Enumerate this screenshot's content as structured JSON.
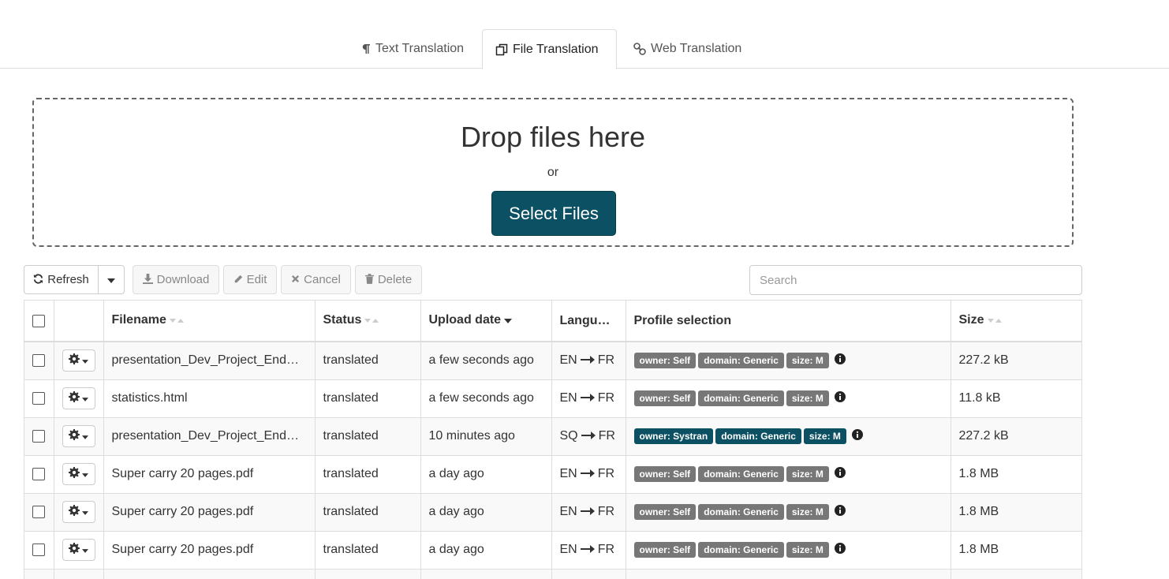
{
  "tabs": [
    {
      "label": "Text Translation",
      "icon": "pilcrow-icon",
      "active": false
    },
    {
      "label": "File Translation",
      "icon": "copy-icon",
      "active": true
    },
    {
      "label": "Web Translation",
      "icon": "link-icon",
      "active": false
    }
  ],
  "dropzone": {
    "title": "Drop files here",
    "or": "or",
    "button": "Select Files"
  },
  "toolbar": {
    "refresh": "Refresh",
    "download": "Download",
    "edit": "Edit",
    "cancel": "Cancel",
    "delete": "Delete",
    "search_placeholder": "Search"
  },
  "table": {
    "columns": {
      "filename": "Filename",
      "status": "Status",
      "upload_date": "Upload date",
      "language": "Langu…",
      "profile": "Profile selection",
      "size": "Size"
    },
    "rows": [
      {
        "filename": "presentation_Dev_Project_End…",
        "status": "translated",
        "date": "a few seconds ago",
        "src": "EN",
        "tgt": "FR",
        "owner": "owner: Self",
        "domain": "domain: Generic",
        "size_badge": "size: M",
        "size": "227.2 kB",
        "badge_color": "#777777"
      },
      {
        "filename": "statistics.html",
        "status": "translated",
        "date": "a few seconds ago",
        "src": "EN",
        "tgt": "FR",
        "owner": "owner: Self",
        "domain": "domain: Generic",
        "size_badge": "size: M",
        "size": "11.8 kB",
        "badge_color": "#777777"
      },
      {
        "filename": "presentation_Dev_Project_End…",
        "status": "translated",
        "date": "10 minutes ago",
        "src": "SQ",
        "tgt": "FR",
        "owner": "owner: Systran",
        "domain": "domain: Generic",
        "size_badge": "size: M",
        "size": "227.2 kB",
        "badge_color": "#0b5063"
      },
      {
        "filename": "Super carry 20 pages.pdf",
        "status": "translated",
        "date": "a day ago",
        "src": "EN",
        "tgt": "FR",
        "owner": "owner: Self",
        "domain": "domain: Generic",
        "size_badge": "size: M",
        "size": "1.8 MB",
        "badge_color": "#777777"
      },
      {
        "filename": "Super carry 20 pages.pdf",
        "status": "translated",
        "date": "a day ago",
        "src": "EN",
        "tgt": "FR",
        "owner": "owner: Self",
        "domain": "domain: Generic",
        "size_badge": "size: M",
        "size": "1.8 MB",
        "badge_color": "#777777"
      },
      {
        "filename": "Super carry 20 pages.pdf",
        "status": "translated",
        "date": "a day ago",
        "src": "EN",
        "tgt": "FR",
        "owner": "owner: Self",
        "domain": "domain: Generic",
        "size_badge": "size: M",
        "size": "1.8 MB",
        "badge_color": "#777777"
      },
      {
        "filename": "",
        "status": "",
        "date": "",
        "src": "",
        "tgt": "",
        "owner": "",
        "domain": "",
        "size_badge": "",
        "size": "",
        "badge_color": "#777777"
      }
    ]
  },
  "colors": {
    "accent": "#0b5063",
    "badge_gray": "#777777"
  }
}
